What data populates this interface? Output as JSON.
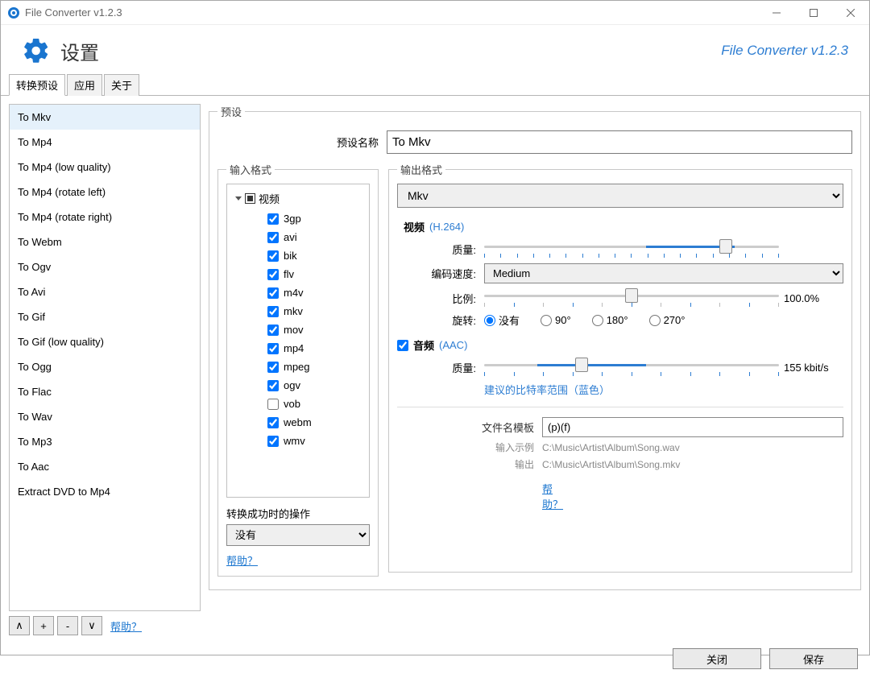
{
  "window": {
    "title": "File Converter v1.2.3",
    "brand": "File Converter v1.2.3"
  },
  "header": {
    "title": "设置"
  },
  "tabs": [
    "转换预设",
    "应用",
    "关于"
  ],
  "presets": [
    "To Mkv",
    "To Mp4",
    "To Mp4 (low quality)",
    "To Mp4 (rotate left)",
    "To Mp4 (rotate right)",
    "To Webm",
    "To Ogv",
    "To Avi",
    "To Gif",
    "To Gif (low quality)",
    "To Ogg",
    "To Flac",
    "To Wav",
    "To Mp3",
    "To Aac",
    "Extract DVD to Mp4"
  ],
  "preset_btns": {
    "up": "∧",
    "add": "+",
    "del": "-",
    "down": "∨"
  },
  "help_label": "帮助？",
  "preset_group": "预设",
  "name_label": "预设名称",
  "name_value": "To Mkv",
  "input_group": "输入格式",
  "tree_root": "视频",
  "tree_items": [
    {
      "label": "3gp",
      "checked": true
    },
    {
      "label": "avi",
      "checked": true
    },
    {
      "label": "bik",
      "checked": true
    },
    {
      "label": "flv",
      "checked": true
    },
    {
      "label": "m4v",
      "checked": true
    },
    {
      "label": "mkv",
      "checked": true
    },
    {
      "label": "mov",
      "checked": true
    },
    {
      "label": "mp4",
      "checked": true
    },
    {
      "label": "mpeg",
      "checked": true
    },
    {
      "label": "ogv",
      "checked": true
    },
    {
      "label": "vob",
      "checked": false
    },
    {
      "label": "webm",
      "checked": true
    },
    {
      "label": "wmv",
      "checked": true
    }
  ],
  "after_label": "转换成功时的操作",
  "after_value": "没有",
  "output_group": "输出格式",
  "output_format": "Mkv",
  "video": {
    "label": "视频",
    "codec": "(H.264)",
    "quality_label": "质量:",
    "speed_label": "编码速度:",
    "speed_value": "Medium",
    "scale_label": "比例:",
    "scale_value": "100.0%",
    "rotate_label": "旋转:",
    "rotate_opts": [
      "没有",
      "90°",
      "180°",
      "270°"
    ]
  },
  "audio": {
    "label": "音频",
    "codec": "(AAC)",
    "quality_label": "质量:",
    "quality_value": "155 kbit/s",
    "tip": "建议的比特率范围（蓝色）"
  },
  "template": {
    "label": "文件名模板",
    "value": "(p)(f)",
    "in_label": "输入示例",
    "in_path": "C:\\Music\\Artist\\Album\\Song.wav",
    "out_label": "输出",
    "out_path": "C:\\Music\\Artist\\Album\\Song.mkv"
  },
  "footer": {
    "close": "关闭",
    "save": "保存"
  }
}
